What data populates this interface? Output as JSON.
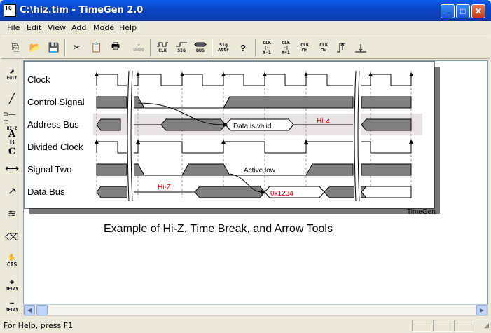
{
  "window": {
    "title": "C:\\hiz.tim - TimeGen 2.0",
    "icon_text": "TG"
  },
  "window_controls": {
    "minimize": "_",
    "maximize": "□",
    "close": "✕"
  },
  "menu": [
    "File",
    "Edit",
    "View",
    "Add",
    "Mode",
    "Help"
  ],
  "toolbar": {
    "undo": "UNDO",
    "clk": "CLK",
    "sig": "SIG",
    "bus": "BUS",
    "sig_attr": [
      "Sig",
      "Attr"
    ],
    "help": "?",
    "clk_x_minus": [
      "CLK",
      "X-1"
    ],
    "clk_x_plus": [
      "CLK",
      "X+1"
    ],
    "clk_a": "CLK",
    "clk_b": "CLK"
  },
  "left_tools": {
    "edit": "Edit",
    "hiz": "HI-Z",
    "delay_plus": "DELAY",
    "delay_minus": "DELAY"
  },
  "diagram": {
    "signals": [
      "Clock",
      "Control Signal",
      "Address Bus",
      "Divided Clock",
      "Signal Two",
      "Data Bus"
    ],
    "annotations": {
      "data_valid": "Data is valid",
      "hiz_address": "Hi-Z",
      "active_low": "Active low",
      "hiz_data": "Hi-Z",
      "data_value": "0x1234"
    },
    "watermark": "TimeGen",
    "caption": "Example of Hi-Z, Time Break, and  Arrow Tools",
    "colors": {
      "waveform_fill": "#808080",
      "hiz_text": "#d40000",
      "highlight": "#e8e4e4"
    }
  },
  "status": {
    "help_text": "For Help, press F1"
  }
}
